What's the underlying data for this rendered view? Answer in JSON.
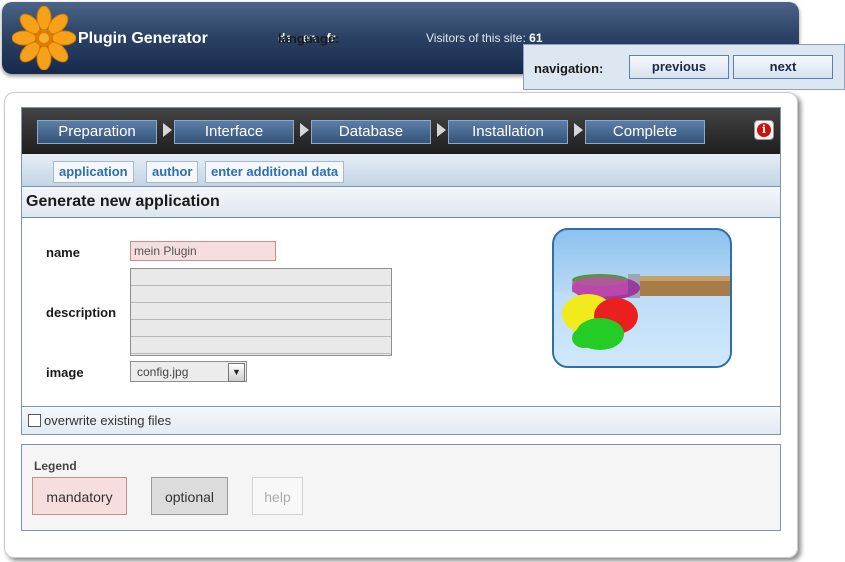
{
  "header": {
    "app_title": "Plugin Generator",
    "language_label": "language:",
    "languages": [
      "de",
      "en",
      "fr"
    ],
    "visitors_label": "Visitors of this site:",
    "visitors_count": "61"
  },
  "navigation": {
    "label": "navigation:",
    "previous": "previous",
    "next": "next"
  },
  "wizard": {
    "steps": [
      "Preparation",
      "Interface",
      "Database",
      "Installation",
      "Complete"
    ],
    "info_icon_glyph": "i"
  },
  "subtabs": [
    "application",
    "author",
    "enter additional data"
  ],
  "section": {
    "title": "Generate new application"
  },
  "form": {
    "name_label": "name",
    "name_value": "mein Plugin",
    "description_label": "description",
    "description_value": "",
    "image_label": "image",
    "image_value": "config.jpg",
    "overwrite_label": "overwrite existing files",
    "overwrite_checked": false
  },
  "legend": {
    "title": "Legend",
    "mandatory": "mandatory",
    "optional": "optional",
    "help": "help"
  },
  "colors": {
    "header_bg": "#1f3557",
    "accent_blue": "#2e6fb0",
    "mandatory_bg": "#f6dede",
    "optional_bg": "#dcdcdc",
    "info_red": "#cc1111"
  },
  "icons": {
    "logo": "orange-flower-icon",
    "info": "info-icon",
    "dropdown": "chevron-down-icon",
    "preview": "paintbrush-splash-image"
  }
}
